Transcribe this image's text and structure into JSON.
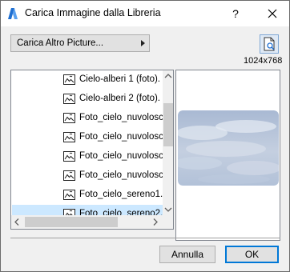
{
  "window": {
    "title": "Carica Immagine dalla Libreria",
    "help_label": "?",
    "close_icon": "close-icon"
  },
  "toolbar": {
    "source_dropdown_label": "Carica Altro Picture...",
    "preview_toggle_icon": "image-preview-icon",
    "resolution": "1024x768"
  },
  "files": {
    "items": [
      {
        "label": "Cielo-alberi 1 (foto).",
        "selected": false
      },
      {
        "label": "Cielo-alberi 2 (foto).",
        "selected": false
      },
      {
        "label": "Foto_cielo_nuvolosc",
        "selected": false
      },
      {
        "label": "Foto_cielo_nuvolosc",
        "selected": false
      },
      {
        "label": "Foto_cielo_nuvolosc",
        "selected": false
      },
      {
        "label": "Foto_cielo_nuvolosc",
        "selected": false
      },
      {
        "label": "Foto_cielo_sereno1.",
        "selected": false
      },
      {
        "label": "Foto_cielo_sereno2.",
        "selected": true
      },
      {
        "label": "",
        "selected": false
      }
    ],
    "item_icon": "picture-file-icon"
  },
  "buttons": {
    "cancel_label": "Annulla",
    "ok_label": "OK"
  },
  "colors": {
    "selection": "#cce8ff",
    "accent": "#0078d7"
  }
}
